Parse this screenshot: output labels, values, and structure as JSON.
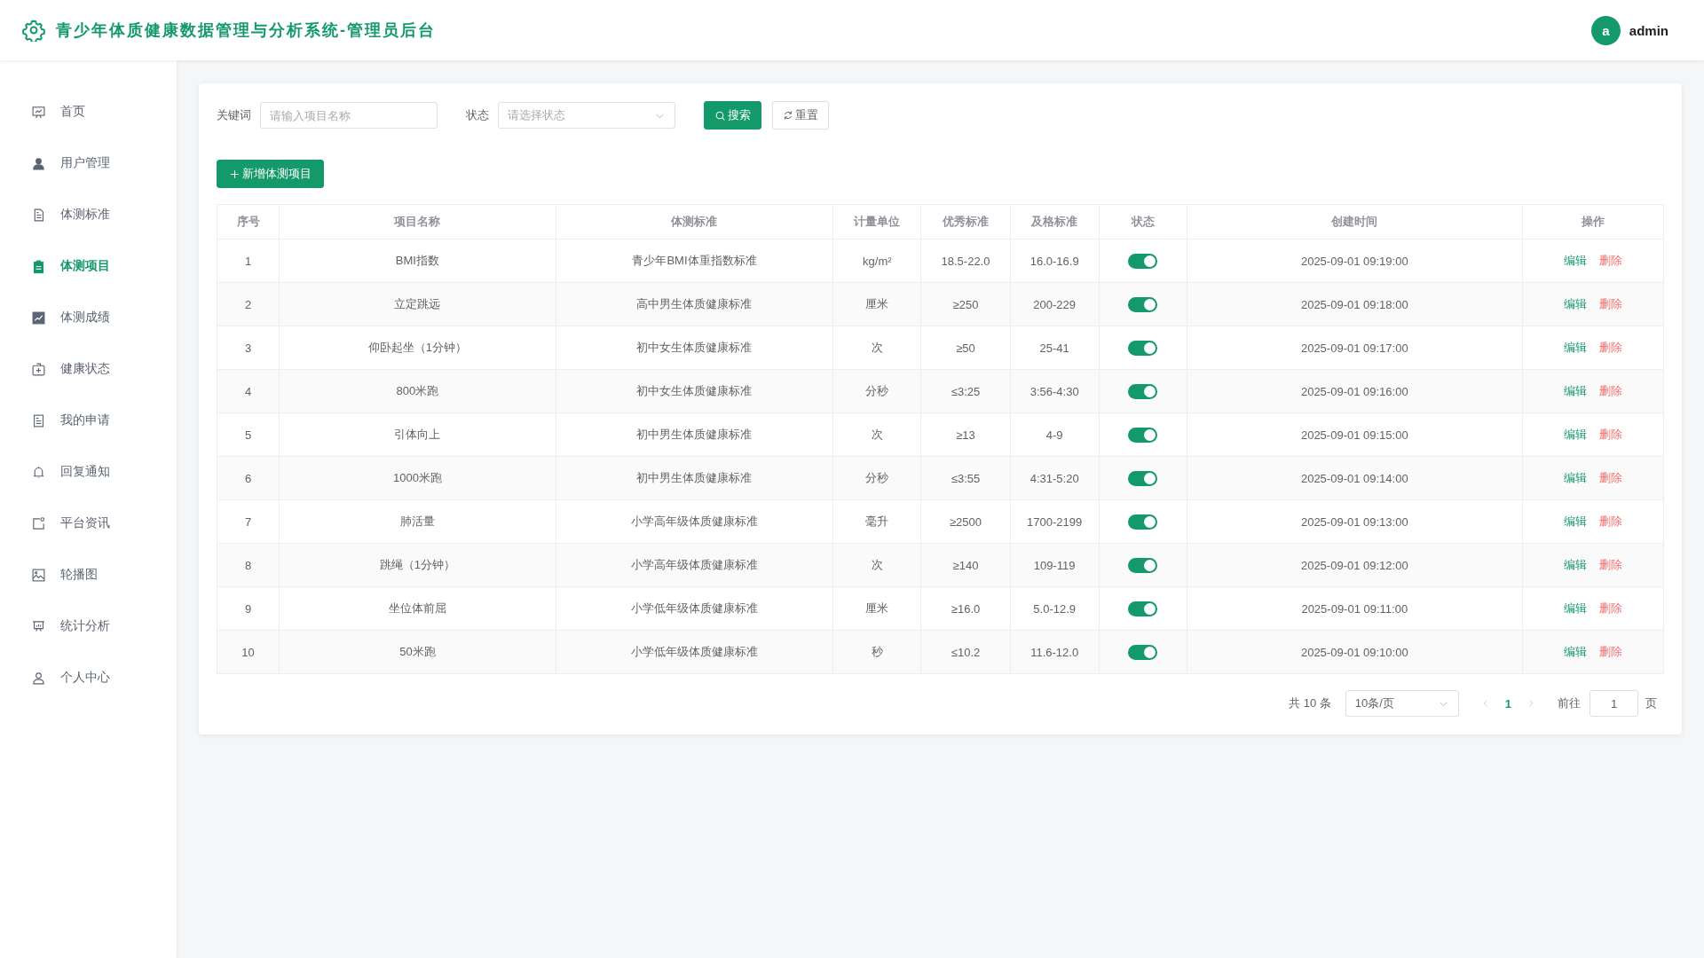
{
  "header": {
    "title": "青少年体质健康数据管理与分析系统-管理员后台",
    "avatar_letter": "a",
    "user_name": "admin"
  },
  "sidebar": {
    "items": [
      {
        "label": "首页",
        "selected": false
      },
      {
        "label": "用户管理",
        "selected": false
      },
      {
        "label": "体测标准",
        "selected": false
      },
      {
        "label": "体测项目",
        "selected": true
      },
      {
        "label": "体测成绩",
        "selected": false
      },
      {
        "label": "健康状态",
        "selected": false
      },
      {
        "label": "我的申请",
        "selected": false
      },
      {
        "label": "回复通知",
        "selected": false
      },
      {
        "label": "平台资讯",
        "selected": false
      },
      {
        "label": "轮播图",
        "selected": false
      },
      {
        "label": "统计分析",
        "selected": false
      },
      {
        "label": "个人中心",
        "selected": false
      }
    ]
  },
  "filters": {
    "keyword_label": "关键词",
    "keyword_placeholder": "请输入项目名称",
    "status_label": "状态",
    "status_placeholder": "请选择状态",
    "search_button": "搜索",
    "reset_button": "重置"
  },
  "add_button": "新增体测项目",
  "table": {
    "columns": [
      "序号",
      "项目名称",
      "体测标准",
      "计量单位",
      "优秀标准",
      "及格标准",
      "状态",
      "创建时间",
      "操作"
    ],
    "rows": [
      {
        "index": "1",
        "name": "BMI指数",
        "standard": "青少年BMI体重指数标准",
        "unit": "kg/m²",
        "excellent": "18.5-22.0",
        "pass": "16.0-16.9",
        "enabled": true,
        "created": "2025-09-01 09:19:00",
        "edit": "编辑",
        "delete": "删除"
      },
      {
        "index": "2",
        "name": "立定跳远",
        "standard": "高中男生体质健康标准",
        "unit": "厘米",
        "excellent": "≥250",
        "pass": "200-229",
        "enabled": true,
        "created": "2025-09-01 09:18:00",
        "edit": "编辑",
        "delete": "删除"
      },
      {
        "index": "3",
        "name": "仰卧起坐（1分钟）",
        "standard": "初中女生体质健康标准",
        "unit": "次",
        "excellent": "≥50",
        "pass": "25-41",
        "enabled": true,
        "created": "2025-09-01 09:17:00",
        "edit": "编辑",
        "delete": "删除"
      },
      {
        "index": "4",
        "name": "800米跑",
        "standard": "初中女生体质健康标准",
        "unit": "分秒",
        "excellent": "≤3:25",
        "pass": "3:56-4:30",
        "enabled": true,
        "created": "2025-09-01 09:16:00",
        "edit": "编辑",
        "delete": "删除"
      },
      {
        "index": "5",
        "name": "引体向上",
        "standard": "初中男生体质健康标准",
        "unit": "次",
        "excellent": "≥13",
        "pass": "4-9",
        "enabled": true,
        "created": "2025-09-01 09:15:00",
        "edit": "编辑",
        "delete": "删除"
      },
      {
        "index": "6",
        "name": "1000米跑",
        "standard": "初中男生体质健康标准",
        "unit": "分秒",
        "excellent": "≤3:55",
        "pass": "4:31-5:20",
        "enabled": true,
        "created": "2025-09-01 09:14:00",
        "edit": "编辑",
        "delete": "删除"
      },
      {
        "index": "7",
        "name": "肺活量",
        "standard": "小学高年级体质健康标准",
        "unit": "毫升",
        "excellent": "≥2500",
        "pass": "1700-2199",
        "enabled": true,
        "created": "2025-09-01 09:13:00",
        "edit": "编辑",
        "delete": "删除"
      },
      {
        "index": "8",
        "name": "跳绳（1分钟）",
        "standard": "小学高年级体质健康标准",
        "unit": "次",
        "excellent": "≥140",
        "pass": "109-119",
        "enabled": true,
        "created": "2025-09-01 09:12:00",
        "edit": "编辑",
        "delete": "删除"
      },
      {
        "index": "9",
        "name": "坐位体前屈",
        "standard": "小学低年级体质健康标准",
        "unit": "厘米",
        "excellent": "≥16.0",
        "pass": "5.0-12.9",
        "enabled": true,
        "created": "2025-09-01 09:11:00",
        "edit": "编辑",
        "delete": "删除"
      },
      {
        "index": "10",
        "name": "50米跑",
        "standard": "小学低年级体质健康标准",
        "unit": "秒",
        "excellent": "≤10.2",
        "pass": "11.6-12.0",
        "enabled": true,
        "created": "2025-09-01 09:10:00",
        "edit": "编辑",
        "delete": "删除"
      }
    ]
  },
  "pagination": {
    "total": "共 10 条",
    "page_size": "10条/页",
    "pages": [
      {
        "label": "1",
        "selected": true
      }
    ],
    "goto_label": "前往",
    "goto_value": "1",
    "page_suffix": "页"
  }
}
